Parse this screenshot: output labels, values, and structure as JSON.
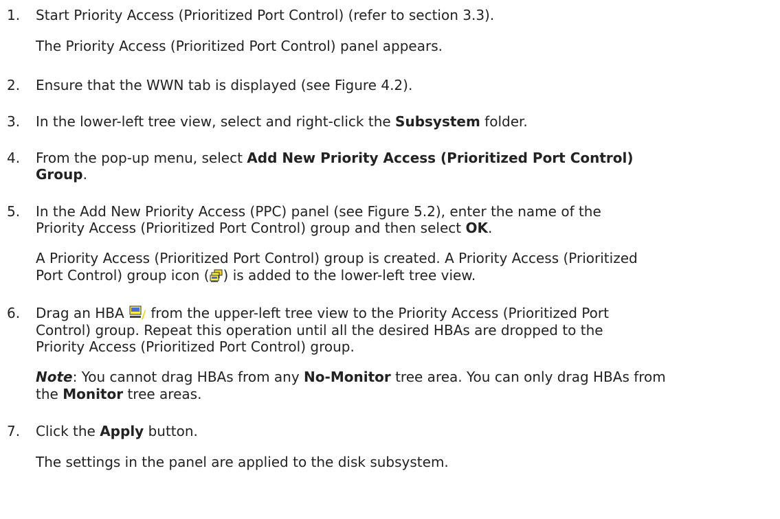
{
  "steps": [
    {
      "number": "1.",
      "line1": "Start Priority Access (Prioritized Port Control) (refer to section 3.3).",
      "result": "The Priority Access (Prioritized Port Control) panel appears."
    },
    {
      "number": "2.",
      "line1": "Ensure that the WWN tab is displayed (see Figure 4.2)."
    },
    {
      "number": "3.",
      "pre": "In the lower-left tree view, select and right-click the ",
      "bold": "Subsystem",
      "post": " folder."
    },
    {
      "number": "4.",
      "pre": "From the pop-up menu, select ",
      "bold1": "Add New Priority Access (Prioritized Port Control)",
      "bold2": "Group",
      "post": "."
    },
    {
      "number": "5.",
      "line1": "In the Add New Priority Access (PPC) panel (see Figure 5.2), enter the name of the",
      "line2_pre": "Priority Access (Prioritized Port Control) group and then select ",
      "line2_bold": "OK",
      "line2_post": ".",
      "result1": "A Priority Access (Prioritized Port Control) group is created. A Priority Access (Prioritized",
      "result2_pre": "Port Control) group icon (",
      "result2_post": ") is added to the lower-left tree view.",
      "icon": "ppc-group-icon"
    },
    {
      "number": "6.",
      "line1_pre": "Drag an HBA ",
      "line1_post": " from the upper-left tree view to the Priority Access (Prioritized Port",
      "line2": "Control) group. Repeat this operation until all the desired HBAs are dropped to the",
      "line3": "Priority Access (Prioritized Port Control) group.",
      "icon": "hba-icon",
      "note_label": "Note",
      "note_pre": ": You cannot drag HBAs from any ",
      "note_bold1": "No-Monitor",
      "note_mid": " tree area. You can only drag HBAs from",
      "note2_pre": "the ",
      "note2_bold": "Monitor",
      "note2_post": " tree areas."
    },
    {
      "number": "7.",
      "pre": "Click the ",
      "bold": "Apply",
      "post": " button.",
      "result": "The settings in the panel are applied to the disk subsystem."
    }
  ]
}
